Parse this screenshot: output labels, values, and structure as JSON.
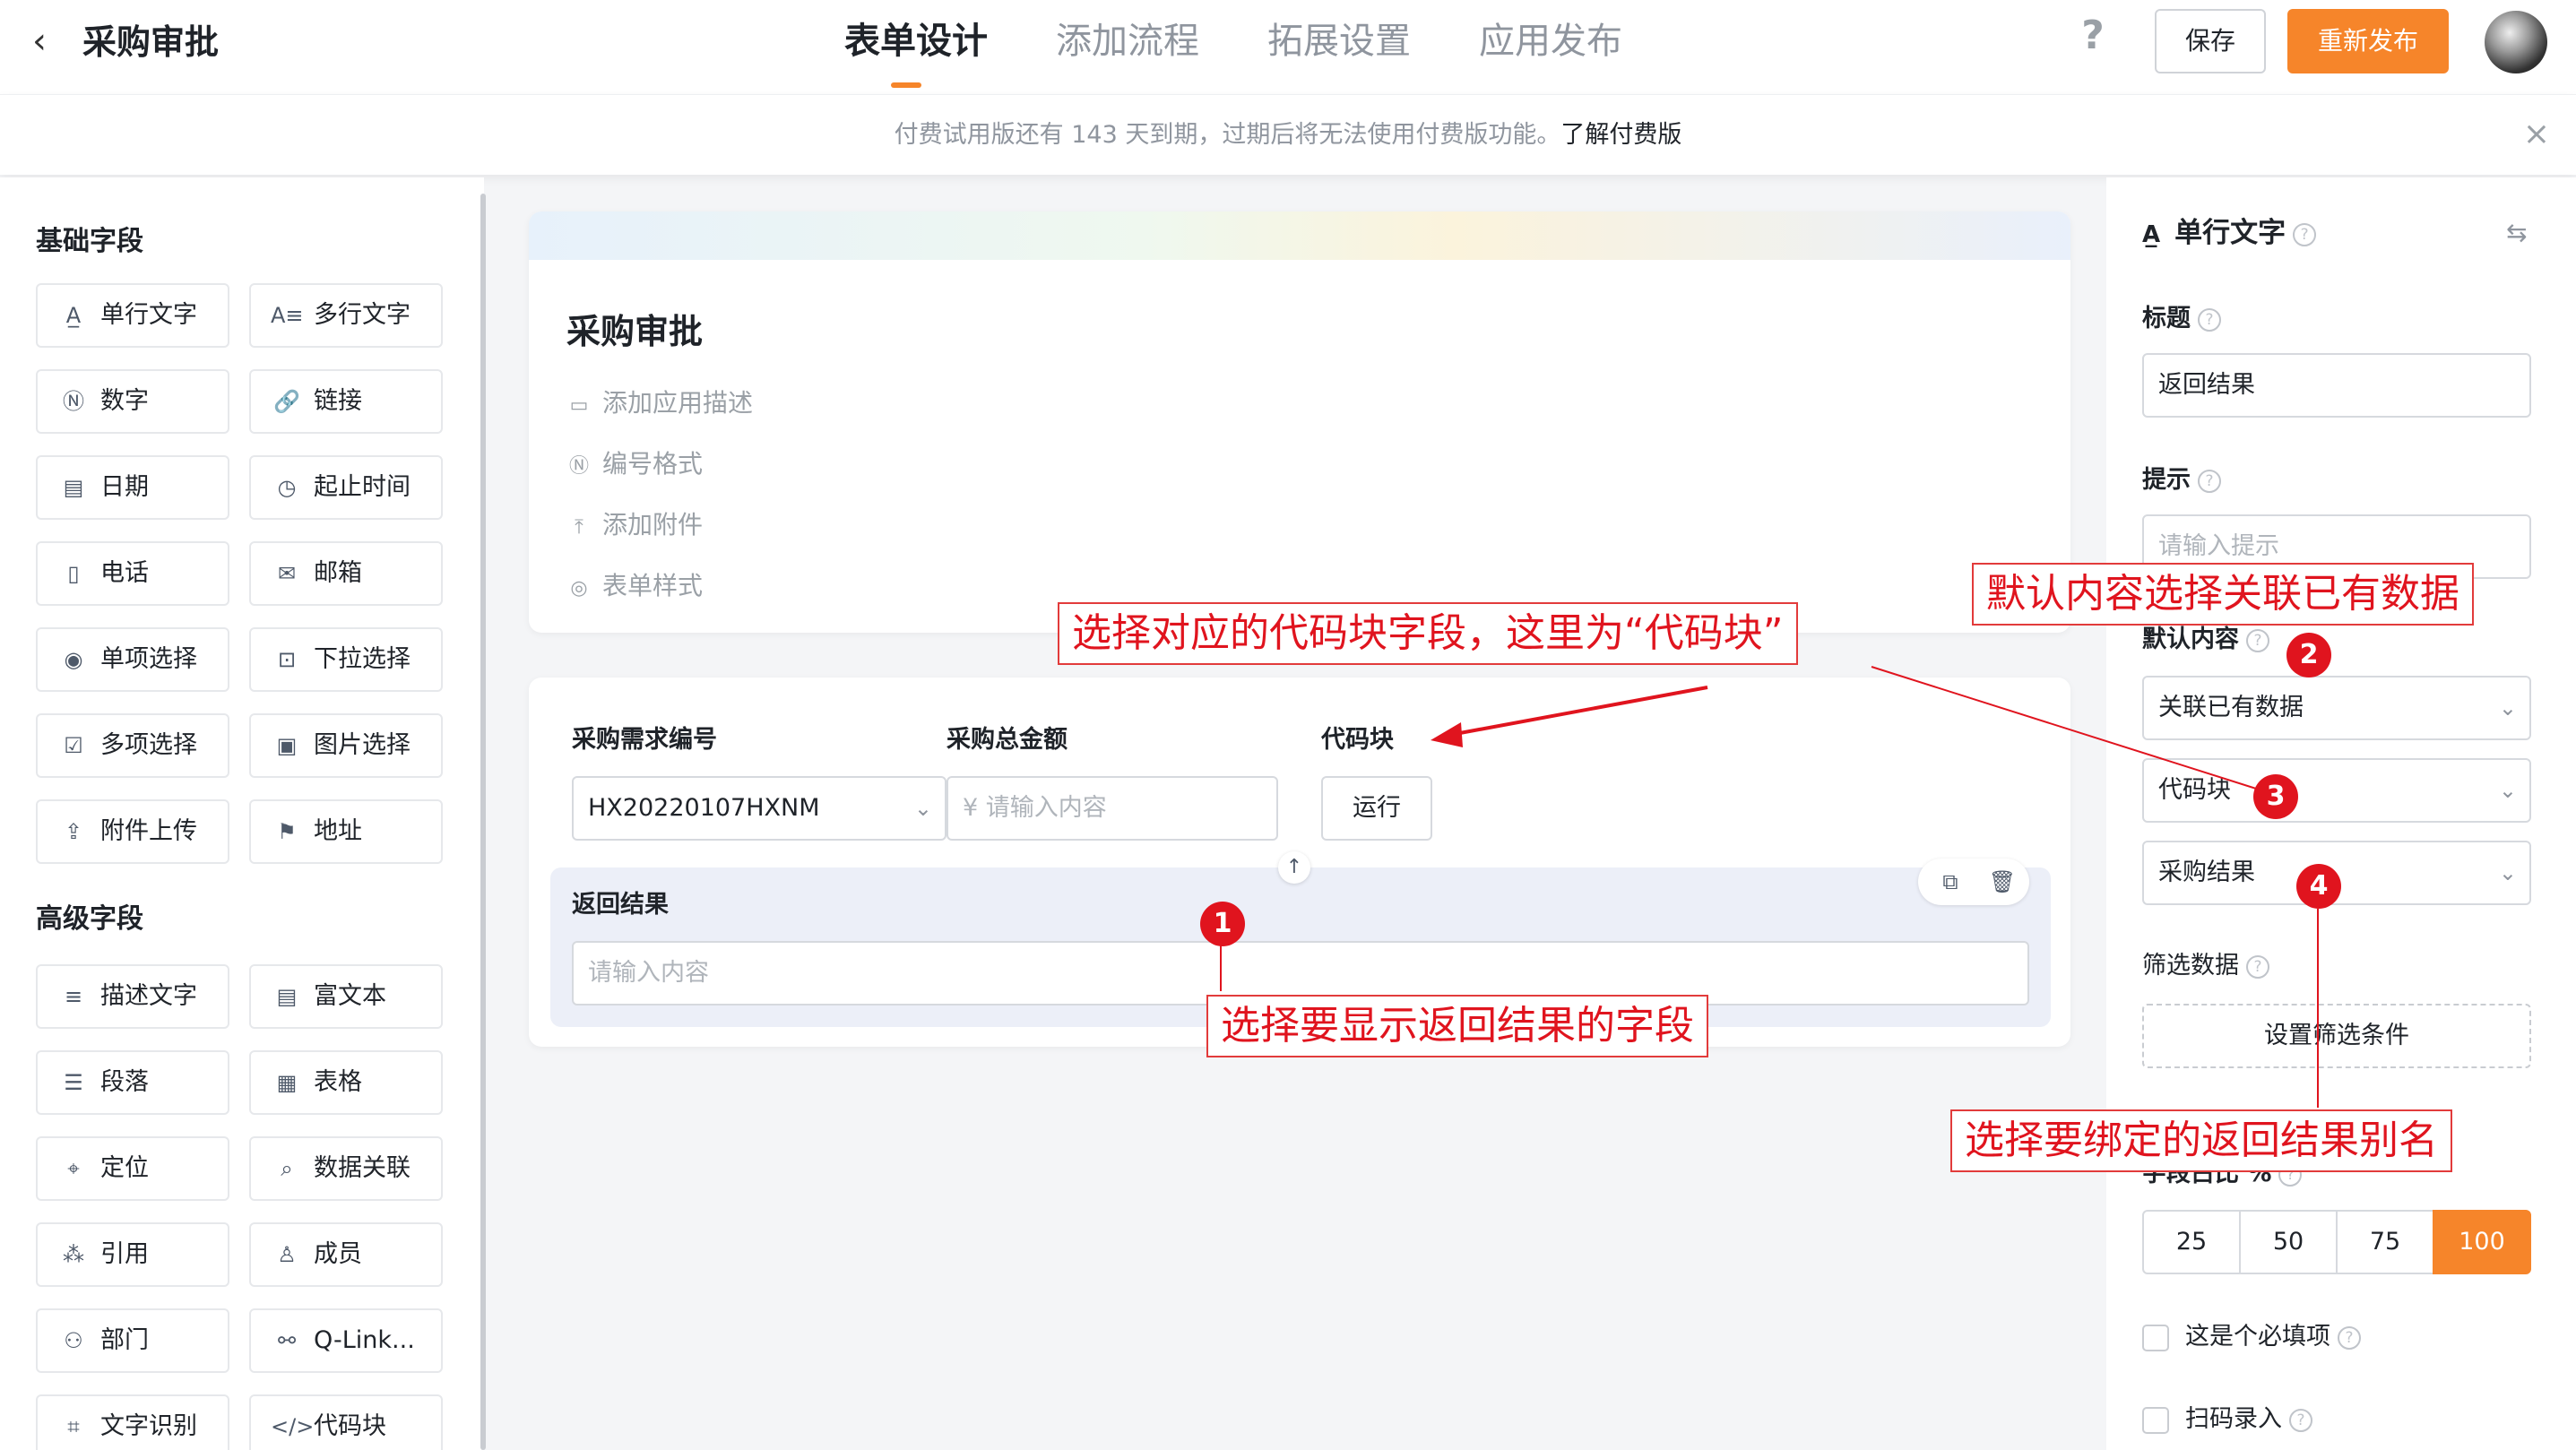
{
  "header": {
    "back_icon": "chevron-left-icon",
    "title": "采购审批",
    "tabs": [
      {
        "label": "表单设计",
        "active": true
      },
      {
        "label": "添加流程",
        "active": false
      },
      {
        "label": "拓展设置",
        "active": false
      },
      {
        "label": "应用发布",
        "active": false
      }
    ],
    "help": "?",
    "save_label": "保存",
    "republish_label": "重新发布",
    "accent_color": "#f6852a"
  },
  "notice": {
    "text": "付费试用版还有 143 天到期，过期后将无法使用付费版功能。",
    "link": "了解付费版",
    "close": "×"
  },
  "left_panel": {
    "basic_title": "基础字段",
    "basic_fields": [
      {
        "label": "单行文字",
        "icon": "A̲"
      },
      {
        "label": "多行文字",
        "icon": "A≡"
      },
      {
        "label": "数字",
        "icon": "Ⓝ"
      },
      {
        "label": "链接",
        "icon": "🔗"
      },
      {
        "label": "日期",
        "icon": "▤"
      },
      {
        "label": "起止时间",
        "icon": "◷"
      },
      {
        "label": "电话",
        "icon": "▯"
      },
      {
        "label": "邮箱",
        "icon": "✉"
      },
      {
        "label": "单项选择",
        "icon": "◉"
      },
      {
        "label": "下拉选择",
        "icon": "⊡"
      },
      {
        "label": "多项选择",
        "icon": "☑"
      },
      {
        "label": "图片选择",
        "icon": "▣"
      },
      {
        "label": "附件上传",
        "icon": "⇪"
      },
      {
        "label": "地址",
        "icon": "⚑"
      }
    ],
    "advanced_title": "高级字段",
    "advanced_fields": [
      {
        "label": "描述文字",
        "icon": "≡"
      },
      {
        "label": "富文本",
        "icon": "▤"
      },
      {
        "label": "段落",
        "icon": "☰"
      },
      {
        "label": "表格",
        "icon": "▦"
      },
      {
        "label": "定位",
        "icon": "⌖"
      },
      {
        "label": "数据关联",
        "icon": "⌕"
      },
      {
        "label": "引用",
        "icon": "⁂"
      },
      {
        "label": "成员",
        "icon": "♙"
      },
      {
        "label": "部门",
        "icon": "⚇"
      },
      {
        "label": "Q-Link...",
        "icon": "⚯"
      },
      {
        "label": "文字识别",
        "icon": "⌗"
      },
      {
        "label": "代码块",
        "icon": "</>"
      }
    ]
  },
  "canvas": {
    "form_title": "采购审批",
    "meta_items": [
      {
        "label": "添加应用描述",
        "icon": "▭"
      },
      {
        "label": "编号格式",
        "icon": "Ⓝ"
      },
      {
        "label": "添加附件",
        "icon": "⤒"
      },
      {
        "label": "表单样式",
        "icon": "◎"
      }
    ],
    "fields": {
      "req_no_label": "采购需求编号",
      "req_no_value": "HX20220107HXNM",
      "amount_label": "采购总金额",
      "amount_placeholder": "¥ 请输入内容",
      "code_label": "代码块",
      "run_label": "运行",
      "result_label": "返回结果",
      "result_placeholder": "请输入内容"
    }
  },
  "right_panel": {
    "field_type": "单行文字",
    "title_label": "标题",
    "title_value": "返回结果",
    "hint_label": "提示",
    "hint_placeholder": "请输入提示",
    "default_label": "默认内容",
    "default_select": "关联已有数据",
    "code_select": "代码块",
    "result_select": "采购结果",
    "filter_label": "筛选数据",
    "filter_button": "设置筛选条件",
    "width_label": "字段占比 %",
    "width_options": [
      "25",
      "50",
      "75",
      "100"
    ],
    "width_selected": "100",
    "required_label": "这是个必填项",
    "scan_label": "扫码录入"
  },
  "annotations": {
    "callout_code": "选择对应的代码块字段，这里为“代码块”",
    "callout_default": "默认内容选择关联已有数据",
    "callout_field": "选择要显示返回结果的字段",
    "callout_alias": "选择要绑定的返回结果别名",
    "badges": [
      "1",
      "2",
      "3",
      "4"
    ],
    "color": "#e0141e"
  }
}
